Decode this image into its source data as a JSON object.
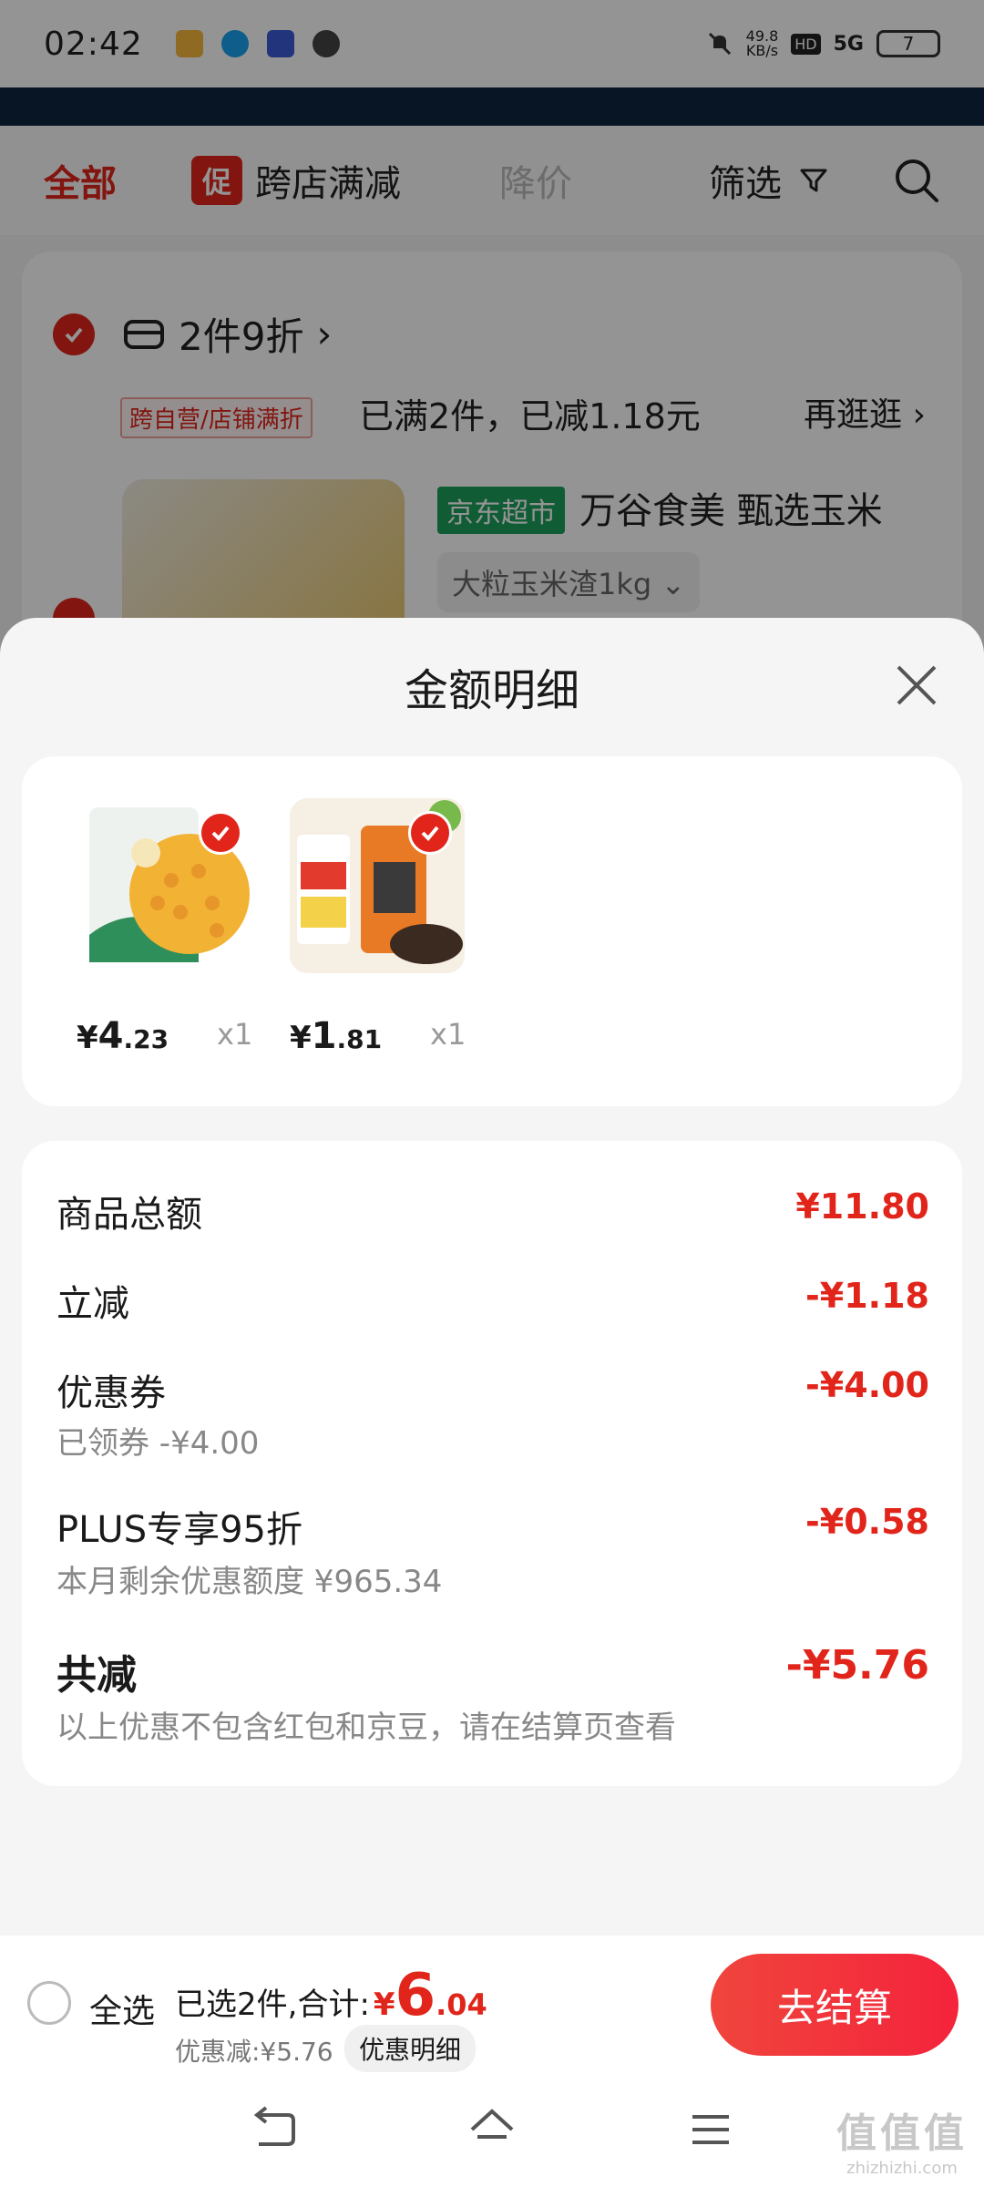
{
  "status_bar": {
    "time": "02:42",
    "net_speed_value": "49.8",
    "net_speed_unit": "KB/s",
    "hd": "HD",
    "signal": "5G",
    "battery": "7",
    "icons": [
      "app-icon",
      "qq-icon",
      "tieba-icon",
      "chat-icon",
      "mute-icon"
    ]
  },
  "tabs": {
    "all": "全部",
    "promo_badge": "促",
    "cross_store": "跨店满减",
    "price_drop": "降价",
    "filter": "筛选"
  },
  "cart_group": {
    "title": "2件9折",
    "promo_tag": "跨自营/店铺满折",
    "status": "已满2件，已减1.18元",
    "more": "再逛逛 ›",
    "product_tag": "京东超市",
    "product_name": "万谷食美 甄选玉米",
    "product_spec": "大粒玉米渣1kg"
  },
  "sheet": {
    "title": "金额明细",
    "items": [
      {
        "currency": "¥",
        "price_int": "4",
        "price_dec": ".23",
        "qty": "x1"
      },
      {
        "currency": "¥",
        "price_int": "1",
        "price_dec": ".81",
        "qty": "x1"
      }
    ],
    "rows": {
      "subtotal": {
        "label": "商品总额",
        "amount": "¥11.80"
      },
      "instant": {
        "label": "立减",
        "amount": "-¥1.18"
      },
      "coupon": {
        "label": "优惠券",
        "sub": "已领券 -¥4.00",
        "amount": "-¥4.00"
      },
      "plus": {
        "label": "PLUS专享95折",
        "sub": "本月剩余优惠额度 ¥965.34",
        "amount": "-¥0.58"
      },
      "total": {
        "label": "共减",
        "sub": "以上优惠不包含红包和京豆，请在结算页查看",
        "amount": "-¥5.76"
      }
    }
  },
  "bottom_bar": {
    "select_all": "全选",
    "selected_prefix": "已选2件,合计:",
    "total_currency": "¥",
    "total_int": "6",
    "total_dec": ".04",
    "discount": "优惠减:¥5.76",
    "detail_chip": "优惠明细",
    "checkout": "去结算"
  },
  "watermark": {
    "big": "值值值",
    "small": "zhizhizhi.com"
  },
  "colors": {
    "accent": "#e1251b",
    "checkout_start": "#f0453d",
    "checkout_end": "#f4233b",
    "jd_green": "#1d9f5c"
  }
}
